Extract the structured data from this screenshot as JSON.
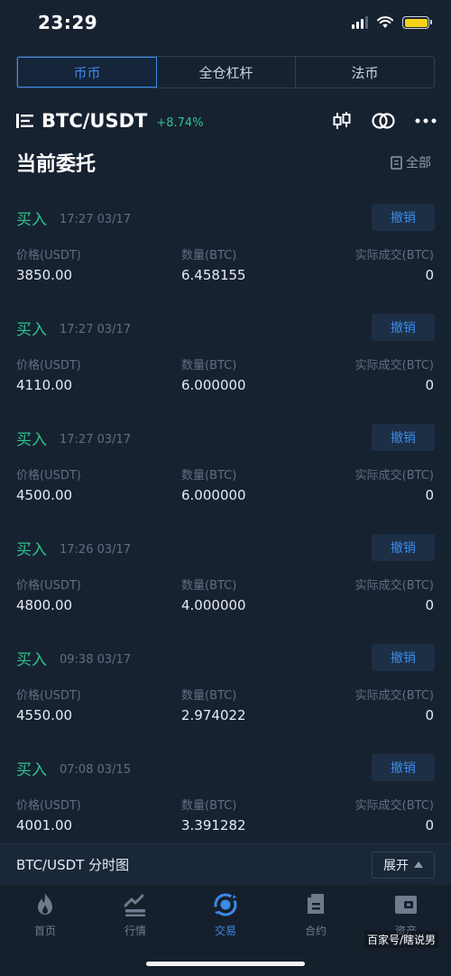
{
  "status_bar": {
    "time": "23:29"
  },
  "tabs": [
    {
      "label": "币币",
      "active": true
    },
    {
      "label": "全仓杠杆",
      "active": false
    },
    {
      "label": "法币",
      "active": false
    }
  ],
  "pair": {
    "name": "BTC/USDT",
    "change": "+8.74%"
  },
  "section": {
    "title": "当前委托",
    "all_label": "全部"
  },
  "columns": {
    "price": "价格(USDT)",
    "amount": "数量(BTC)",
    "filled": "实际成交(BTC)"
  },
  "cancel_label": "撤销",
  "orders": [
    {
      "side": "买入",
      "time": "17:27 03/17",
      "price": "3850.00",
      "amount": "6.458155",
      "filled": "0"
    },
    {
      "side": "买入",
      "time": "17:27 03/17",
      "price": "4110.00",
      "amount": "6.000000",
      "filled": "0"
    },
    {
      "side": "买入",
      "time": "17:27 03/17",
      "price": "4500.00",
      "amount": "6.000000",
      "filled": "0"
    },
    {
      "side": "买入",
      "time": "17:26 03/17",
      "price": "4800.00",
      "amount": "4.000000",
      "filled": "0"
    },
    {
      "side": "买入",
      "time": "09:38 03/17",
      "price": "4550.00",
      "amount": "2.974022",
      "filled": "0"
    },
    {
      "side": "买入",
      "time": "07:08 03/15",
      "price": "4001.00",
      "amount": "3.391282",
      "filled": "0"
    }
  ],
  "bottom_bar": {
    "title": "BTC/USDT 分时图",
    "expand_label": "展开"
  },
  "nav": [
    {
      "label": "首页",
      "icon": "flame-icon",
      "active": false
    },
    {
      "label": "行情",
      "icon": "chart-icon",
      "active": false
    },
    {
      "label": "交易",
      "icon": "trade-icon",
      "active": true
    },
    {
      "label": "合约",
      "icon": "contract-icon",
      "active": false
    },
    {
      "label": "资产",
      "icon": "wallet-icon",
      "active": false
    }
  ],
  "watermark": "百家号/瞎说男",
  "colors": {
    "accent": "#3b8bea",
    "buy": "#2ec38d",
    "background": "#172231"
  }
}
